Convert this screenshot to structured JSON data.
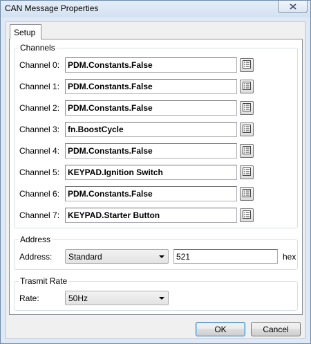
{
  "window": {
    "title": "CAN Message Properties",
    "close_icon": "close-icon"
  },
  "tabs": [
    {
      "label": "Setup",
      "selected": true
    }
  ],
  "channels": {
    "label": "Channels",
    "items": [
      {
        "label": "Channel 0:",
        "value": "PDM.Constants.False"
      },
      {
        "label": "Channel 1:",
        "value": "PDM.Constants.False"
      },
      {
        "label": "Channel 2:",
        "value": "PDM.Constants.False"
      },
      {
        "label": "Channel 3:",
        "value": "fn.BoostCycle"
      },
      {
        "label": "Channel 4:",
        "value": "PDM.Constants.False"
      },
      {
        "label": "Channel 5:",
        "value": "KEYPAD.Ignition Switch"
      },
      {
        "label": "Channel 6:",
        "value": "PDM.Constants.False"
      },
      {
        "label": "Channel 7:",
        "value": "KEYPAD.Starter Button"
      }
    ],
    "picker_icon": "list-picker-icon"
  },
  "address": {
    "label": "Address",
    "field_label": "Address:",
    "type_selected": "Standard",
    "value": "521",
    "suffix": "hex"
  },
  "transmit_rate": {
    "label": "Trasmit Rate",
    "field_label": "Rate:",
    "selected": "50Hz"
  },
  "buttons": {
    "ok": "OK",
    "cancel": "Cancel"
  }
}
